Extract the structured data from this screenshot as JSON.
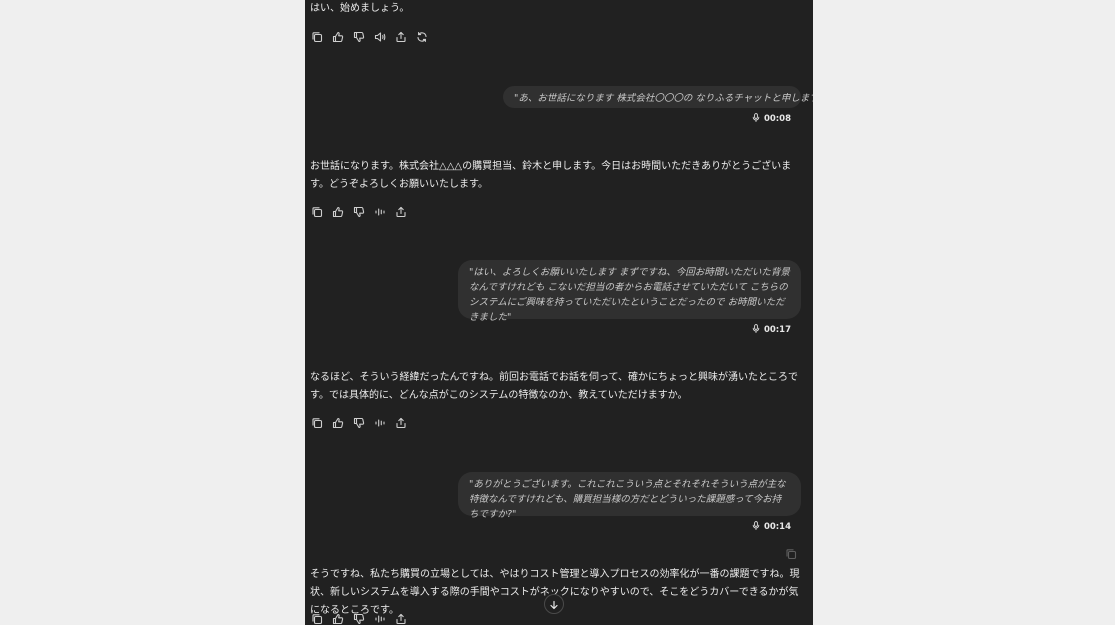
{
  "messages": {
    "ai_0": "はい、始めましょう。",
    "user_1": {
      "text": "\"あ、お世話になります 株式会社〇〇〇の なりふるチャットと申します\"",
      "duration": "00:08"
    },
    "ai_1": "お世話になります。株式会社△△△の購買担当、鈴木と申します。今日はお時間いただきありがとうございます。どうぞよろしくお願いいたします。",
    "user_2": {
      "text": "\"はい、よろしくお願いいたします まずですね、今回お時間いただいた背景なんですけれども こないだ担当の者からお電話させていただいて こちらのシステムにご興味を持っていただいたということだったので お時間いただきました\"",
      "duration": "00:17"
    },
    "ai_2": "なるほど、そういう経緯だったんですね。前回お電話でお話を伺って、確かにちょっと興味が湧いたところです。では具体的に、どんな点がこのシステムの特徴なのか、教えていただけますか。",
    "user_3": {
      "text": "\"ありがとうございます。これこれこういう点とそれそれそういう点が主な特徴なんですけれども、購買担当様の方だとどういった課題感って今お持ちですか?\"",
      "duration": "00:14"
    },
    "ai_3": "そうですね、私たち購買の立場としては、やはりコスト管理と導入プロセスの効率化が一番の課題ですね。現状、新しいシステムを導入する際の手間やコストがネックになりやすいので、そこをどうカバーできるかが気になるところです。"
  },
  "icons": {
    "copy": "copy-icon",
    "like": "thumbs-up-icon",
    "dislike": "thumbs-down-icon",
    "read_aloud": "speaker-icon",
    "voice": "voice-wave-icon",
    "share": "share-icon",
    "regenerate": "regenerate-icon",
    "mic": "mic-icon",
    "scroll_down": "arrow-down-icon"
  },
  "colors": {
    "page_bg": "#efefef",
    "chat_bg": "#212121",
    "bubble_bg": "#303030",
    "text": "#ececec"
  }
}
